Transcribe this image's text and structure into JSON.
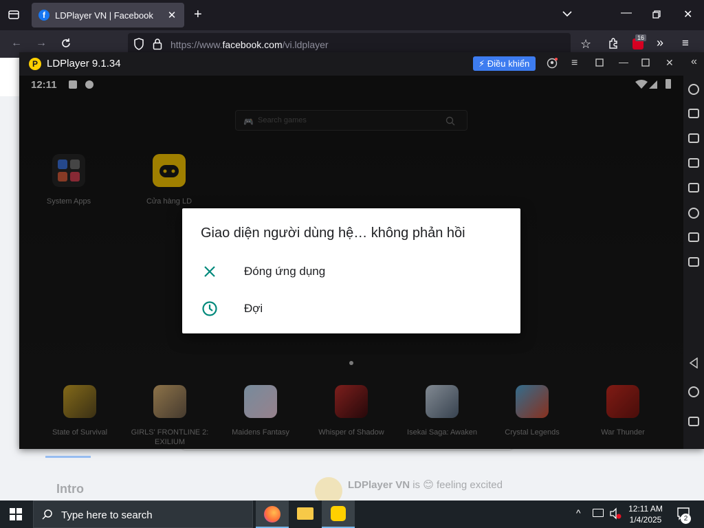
{
  "browser": {
    "tab_title": "LDPlayer VN | Facebook",
    "url_prefix": "https://www.",
    "url_domain": "facebook.com",
    "url_path": "/vi.ldplayer",
    "extension_badge": "16"
  },
  "facebook_page": {
    "intro_heading": "Intro",
    "post_author": "LDPlayer VN",
    "post_status": " is 😊 feeling excited"
  },
  "ldplayer": {
    "window_title": "LDPlayer 9.1.34",
    "control_button": "Điều khiển",
    "status_time": "12:11",
    "search_placeholder": "Search games",
    "desktop_apps": [
      {
        "label": "System Apps"
      },
      {
        "label": "Cửa hàng LD"
      }
    ],
    "dock_apps": [
      {
        "label": "State of Survival"
      },
      {
        "label": "GIRLS' FRONTLINE 2: EXILIUM"
      },
      {
        "label": "Maidens Fantasy"
      },
      {
        "label": "Whisper of Shadow"
      },
      {
        "label": "Isekai Saga: Awaken"
      },
      {
        "label": "Crystal Legends"
      },
      {
        "label": "War Thunder"
      }
    ],
    "dialog": {
      "title": "Giao diện người dùng hệ… không phản hồi",
      "option_close": "Đóng ứng dụng",
      "option_wait": "Đợi"
    }
  },
  "taskbar": {
    "search_text": "Type here to search",
    "time": "12:11 AM",
    "date": "1/4/2025",
    "notifications": "2"
  },
  "colors": {
    "dialog_icon": "#00897b",
    "ld_control_bg": "#3d7cf0",
    "ld_yellow": "#ffd000"
  }
}
